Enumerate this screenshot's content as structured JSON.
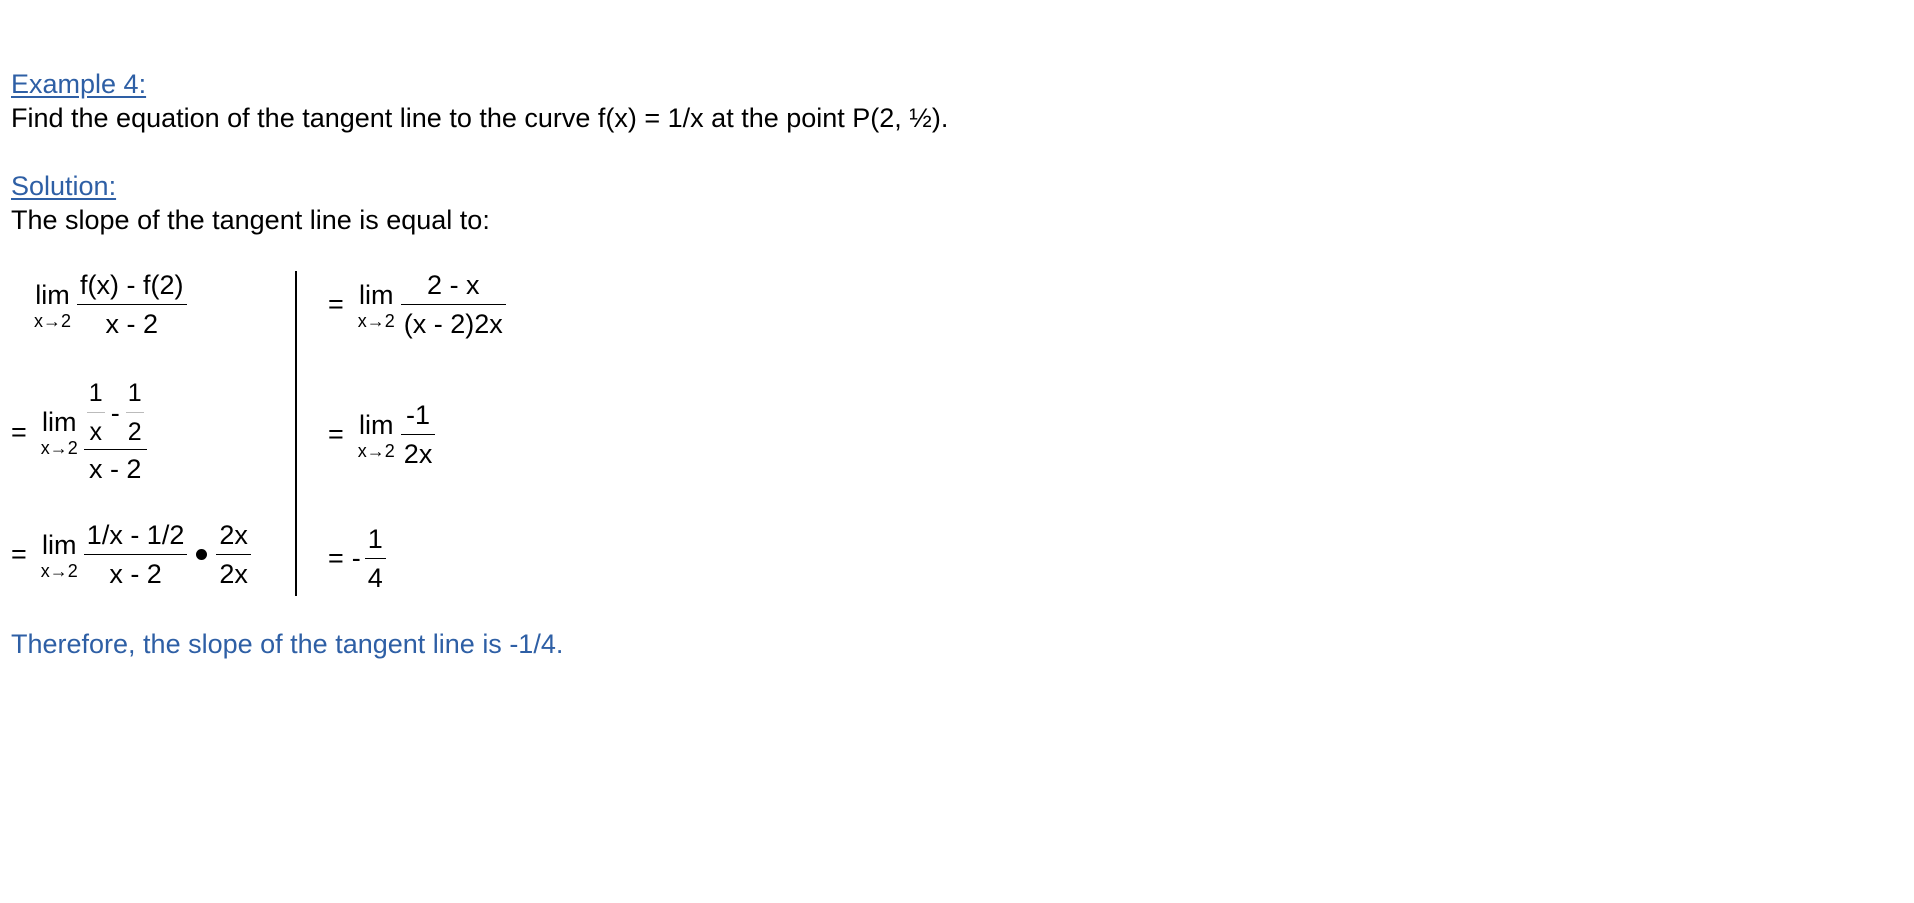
{
  "example": {
    "heading": "Example 4:",
    "problem": "Find the equation of the tangent line to the curve f(x) = 1/x at the point P(2, ½)."
  },
  "solution": {
    "heading": "Solution:",
    "intro": "The slope of the tangent line is equal to:"
  },
  "math": {
    "lim_word": "lim",
    "lim_sub": "x→2",
    "equals": "=",
    "step1": {
      "num": "f(x) - f(2)",
      "den": "x - 2"
    },
    "step2": {
      "inner_a_num": "1",
      "inner_a_den": "x",
      "inner_minus": "-",
      "inner_b_num": "1",
      "inner_b_den": "2",
      "den": "x - 2"
    },
    "step3": {
      "num": "1/x - 1/2",
      "den": "x - 2",
      "mult_num": "2x",
      "mult_den": "2x"
    },
    "step4": {
      "num": "2 - x",
      "den": "(x - 2)2x"
    },
    "step5": {
      "num": "-1",
      "den": "2x"
    },
    "step6": {
      "sign": "-",
      "num": "1",
      "den": "4"
    }
  },
  "conclusion": "Therefore, the slope of the tangent line is -1/4."
}
